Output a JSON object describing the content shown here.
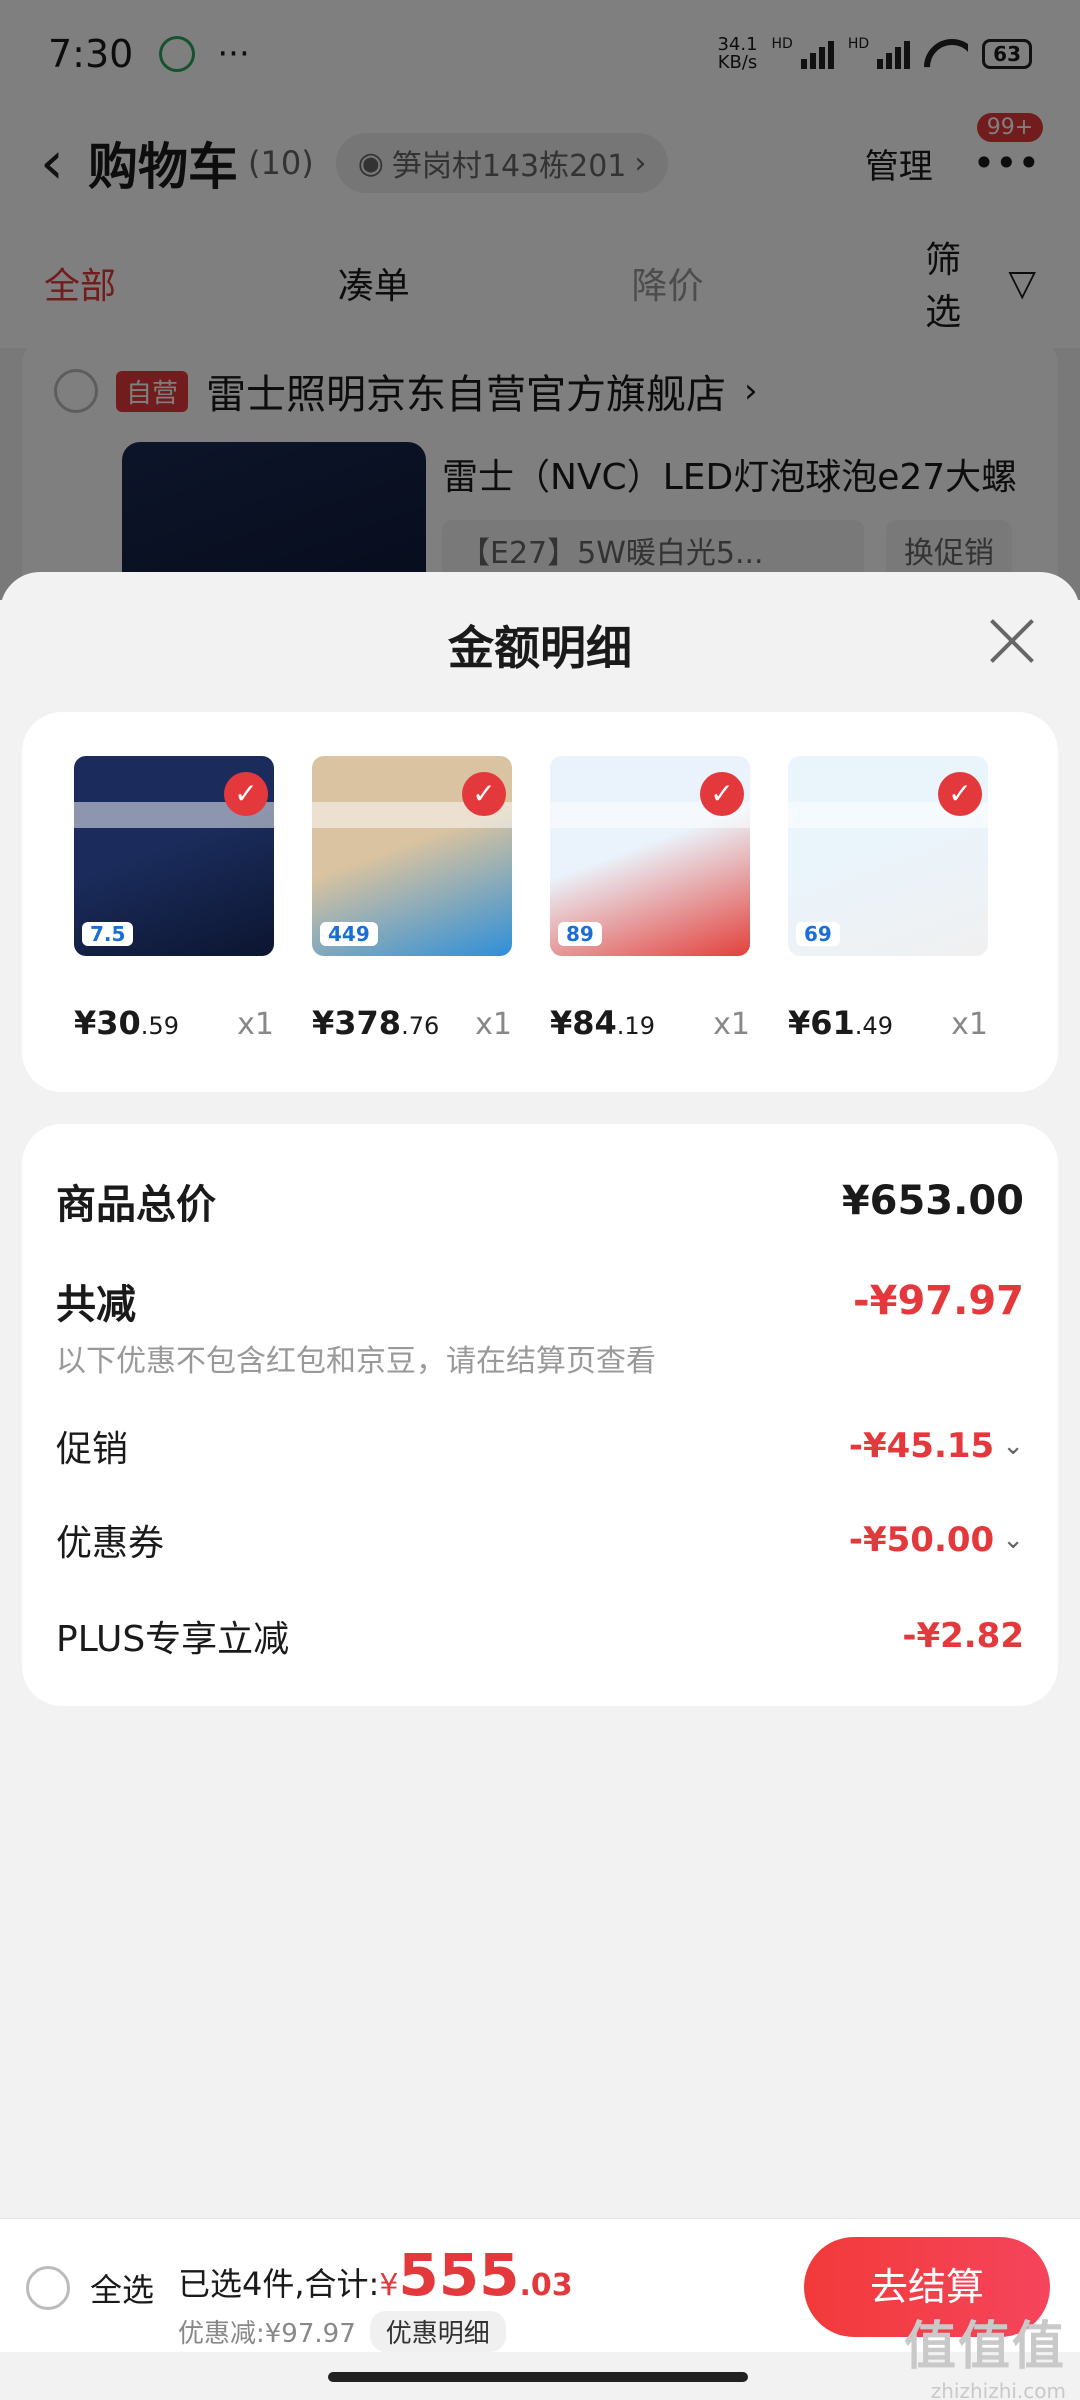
{
  "status_bar": {
    "time": "7:30",
    "dots": "···",
    "net_speed_value": "34.1",
    "net_speed_unit": "KB/s",
    "hd_1": "HD",
    "hd_2": "HD",
    "battery": "63"
  },
  "header": {
    "title": "购物车",
    "count": "(10)",
    "address": "笋岗村143栋201",
    "manage_label": "管理",
    "message_badge": "99+"
  },
  "tabs": [
    {
      "label": "全部"
    },
    {
      "label": "凑单"
    },
    {
      "label": "降价"
    }
  ],
  "filter_label": "筛选",
  "store": {
    "tag": "自营",
    "name": "雷士照明京东自营官方旗舰店",
    "product_title": "雷士（NVC）LED灯泡球泡e27大螺",
    "sku": "【E27】5W暖白光5...",
    "promo": "换促销"
  },
  "sheet": {
    "title": "金额明细",
    "products": [
      {
        "name": "nvc-led-bulb",
        "yuan": "¥30",
        "cents": ".59",
        "qty": "x1",
        "badge": "7.5",
        "color_top": "#1b2c5c",
        "color_bottom": "#0c1530"
      },
      {
        "name": "water-heater",
        "yuan": "¥378",
        "cents": ".76",
        "qty": "x1",
        "badge": "449",
        "color_top": "#d9c3a0",
        "color_bottom": "#2e8fd8"
      },
      {
        "name": "midea-meat-grinder",
        "yuan": "¥84",
        "cents": ".19",
        "qty": "x1",
        "badge": "89",
        "color_top": "#eaf3fb",
        "color_bottom": "#e2413b"
      },
      {
        "name": "midea-kettle",
        "yuan": "¥61",
        "cents": ".49",
        "qty": "x1",
        "badge": "69",
        "color_top": "#eaf4fb",
        "color_bottom": "#f0f0f0"
      }
    ],
    "summary": {
      "total_label": "商品总价",
      "total_value": "¥653.00",
      "discount_label": "共减",
      "discount_value": "-¥97.97",
      "note": "以下优惠不包含红包和京豆，请在结算页查看",
      "promo_label": "促销",
      "promo_value": "-¥45.15",
      "coupon_label": "优惠券",
      "coupon_value": "-¥50.00",
      "plus_label": "PLUS专享立减",
      "plus_value": "-¥2.82"
    }
  },
  "bottom_bar": {
    "select_all": "全选",
    "selected_text": "已选4件,合计:",
    "yen": "¥",
    "amount": "555",
    "cents": ".03",
    "discount_text": "优惠减:¥97.97",
    "detail_button": "优惠明细",
    "checkout": "去结算"
  },
  "watermark": {
    "main": "值值值",
    "sub": "zhizhizhi.com"
  },
  "colors": {
    "accent": "#e4393c",
    "background": "#f2f2f2"
  }
}
